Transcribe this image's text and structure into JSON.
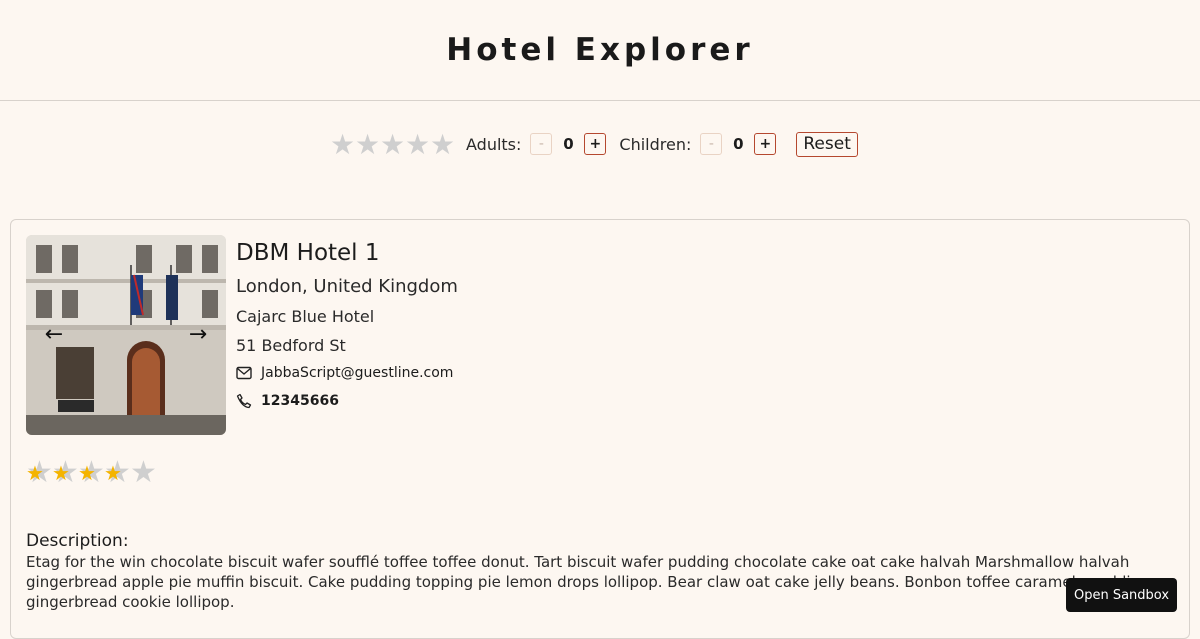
{
  "header": {
    "title": "Hotel Explorer"
  },
  "filters": {
    "star_rating_stars": 5,
    "adults_label": "Adults:",
    "adults_minus": "-",
    "adults_count": "0",
    "adults_plus": "+",
    "children_label": "Children:",
    "children_minus": "-",
    "children_count": "0",
    "children_plus": "+",
    "reset_label": "Reset"
  },
  "hotel": {
    "name": "DBM Hotel 1",
    "location": "London,  United Kingdom",
    "address_line1": "Cajarc Blue Hotel",
    "address_line2": "51 Bedford St",
    "email": "JabbaScript@guestline.com",
    "phone": "12345666",
    "rating": 4,
    "max_rating": 5,
    "description_title": "Description:",
    "description": "Etag for the win chocolate biscuit wafer soufflé toffee toffee donut. Tart biscuit wafer pudding chocolate cake oat cake halvah Marshmallow halvah gingerbread apple pie muffin biscuit. Cake pudding topping pie lemon drops lollipop. Bear claw oat cake jelly beans. Bonbon toffee caramels pudding gingerbread cookie lollipop.",
    "photo_icons": {
      "prev": "arrow-left-icon",
      "next": "arrow-right-icon"
    }
  },
  "sandbox_button": "Open Sandbox",
  "colors": {
    "background": "#fdf7f1",
    "accent": "#b5482f",
    "star_filled": "#f4b400",
    "star_empty": "#cfcfcf"
  }
}
